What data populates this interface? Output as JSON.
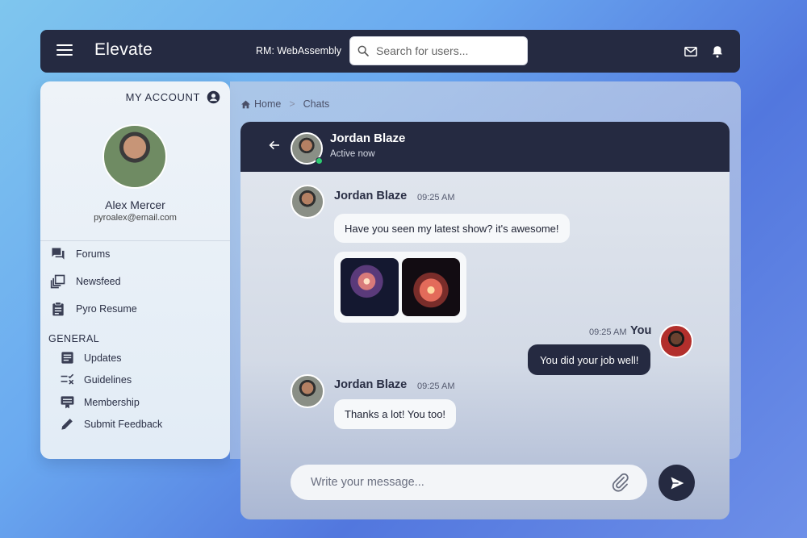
{
  "topbar": {
    "brand": "Elevate",
    "rm_label": "RM: WebAssembly",
    "search_placeholder": "Search for users...",
    "icons": [
      "menu-icon",
      "search-icon",
      "mail-icon",
      "bell-icon"
    ]
  },
  "sidebar": {
    "my_account": "MY ACCOUNT",
    "user_name": "Alex Mercer",
    "user_email": "pyroalex@email.com",
    "nav": [
      {
        "label": "Forums",
        "icon": "forum-icon"
      },
      {
        "label": "Newsfeed",
        "icon": "newsfeed-icon"
      },
      {
        "label": "Pyro Resume",
        "icon": "clipboard-icon"
      }
    ],
    "section_title": "GENERAL",
    "general": [
      {
        "label": "Updates",
        "icon": "article-icon"
      },
      {
        "label": "Guidelines",
        "icon": "checklist-icon"
      },
      {
        "label": "Membership",
        "icon": "membership-card-icon"
      },
      {
        "label": "Submit Feedback",
        "icon": "pencil-icon"
      }
    ]
  },
  "breadcrumb": {
    "home": "Home",
    "separator": ">",
    "current": "Chats"
  },
  "chat": {
    "contact_name": "Jordan Blaze",
    "status": "Active now",
    "messages": [
      {
        "sender": "Jordan Blaze",
        "time": "09:25 AM",
        "text": "Have you seen my latest show? it's awesome!"
      },
      {
        "sender": "You",
        "time": "09:25 AM",
        "text": "You did your job well!"
      },
      {
        "sender": "Jordan Blaze",
        "time": "09:25 AM",
        "text": "Thanks a lot! You too!"
      }
    ],
    "compose_placeholder": "Write your message..."
  },
  "colors": {
    "dark": "#252a41",
    "online": "#2ecc71",
    "bubble": "#f6f8fa"
  }
}
